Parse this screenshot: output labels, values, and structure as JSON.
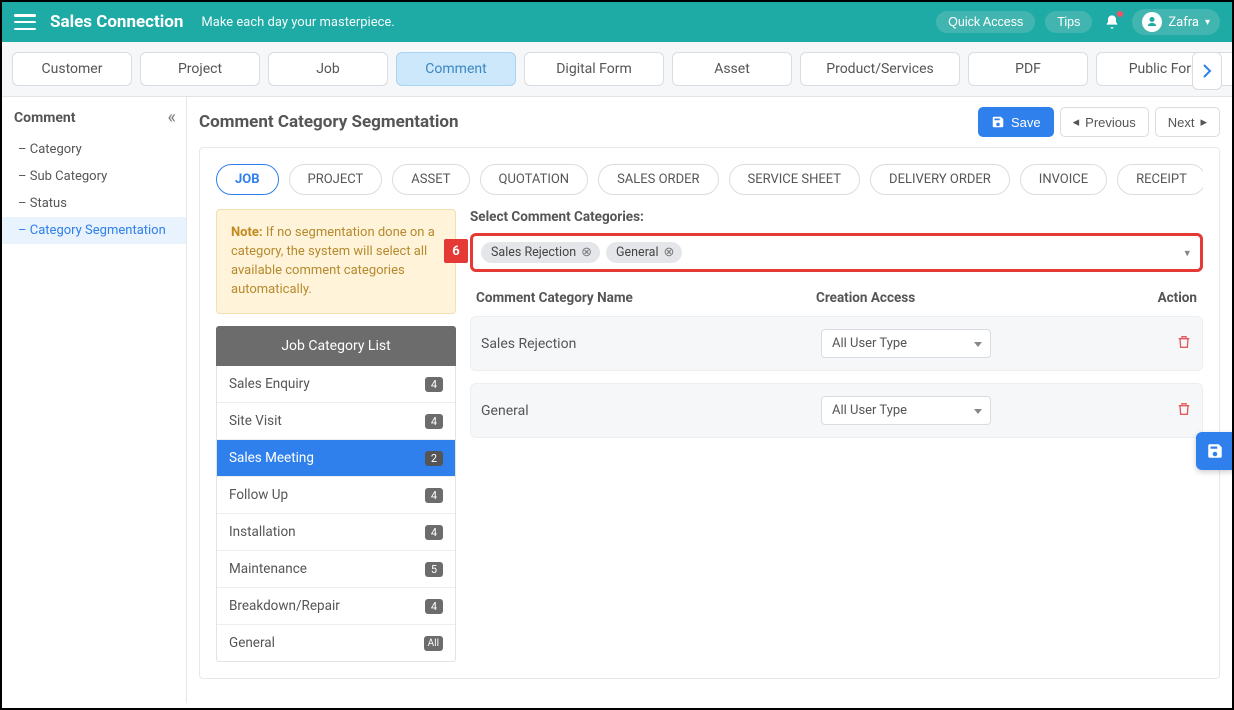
{
  "topbar": {
    "brand": "Sales Connection",
    "tagline": "Make each day your masterpiece.",
    "quick_access": "Quick Access",
    "tips": "Tips",
    "user_name": "Zafra"
  },
  "nav_tabs": [
    "Customer",
    "Project",
    "Job",
    "Comment",
    "Digital Form",
    "Asset",
    "Product/Services",
    "PDF",
    "Public Form"
  ],
  "nav_active": "Comment",
  "side": {
    "title": "Comment",
    "items": [
      "Category",
      "Sub Category",
      "Status",
      "Category Segmentation"
    ],
    "active": "Category Segmentation"
  },
  "page": {
    "title": "Comment Category Segmentation",
    "save": "Save",
    "prev": "Previous",
    "next": "Next"
  },
  "sub_tabs": [
    "JOB",
    "PROJECT",
    "ASSET",
    "QUOTATION",
    "SALES ORDER",
    "SERVICE SHEET",
    "DELIVERY ORDER",
    "INVOICE",
    "RECEIPT"
  ],
  "sub_active": "JOB",
  "note_label": "Note:",
  "note_text": " If no segmentation done on a category, the system will select all available comment categories automatically.",
  "cat_list_header": "Job Category List",
  "cat_list": [
    {
      "name": "Sales Enquiry",
      "count": "4"
    },
    {
      "name": "Site Visit",
      "count": "4"
    },
    {
      "name": "Sales Meeting",
      "count": "2",
      "active": true
    },
    {
      "name": "Follow Up",
      "count": "4"
    },
    {
      "name": "Installation",
      "count": "4"
    },
    {
      "name": "Maintenance",
      "count": "5"
    },
    {
      "name": "Breakdown/Repair",
      "count": "4"
    },
    {
      "name": "General",
      "count": "All",
      "all": true
    }
  ],
  "select_label": "Select Comment Categories:",
  "marker": "6",
  "chips": [
    "Sales Rejection",
    "General"
  ],
  "table": {
    "head": {
      "name": "Comment Category Name",
      "access": "Creation Access",
      "action": "Action"
    },
    "rows": [
      {
        "name": "Sales Rejection",
        "access": "All User Type"
      },
      {
        "name": "General",
        "access": "All User Type"
      }
    ]
  }
}
